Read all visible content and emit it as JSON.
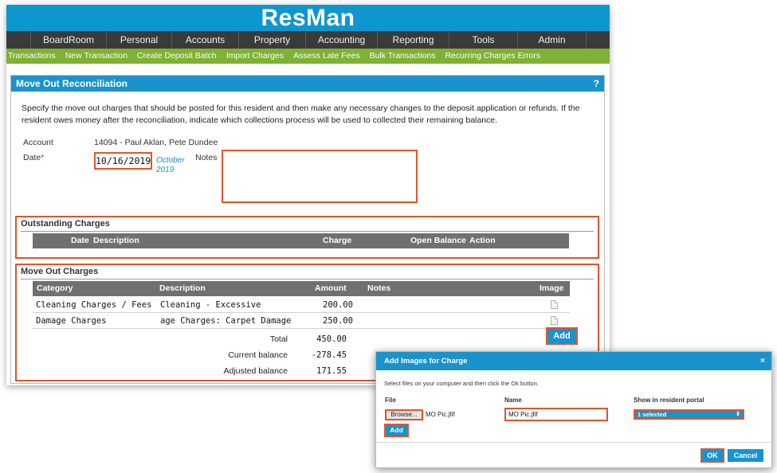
{
  "app": {
    "brand": "ResMan"
  },
  "top_nav": [
    "BoardRoom",
    "Personal",
    "Accounts",
    "Property",
    "Accounting",
    "Reporting",
    "Tools",
    "Admin"
  ],
  "sub_nav": [
    "Transactions",
    "New Transaction",
    "Create Deposit Batch",
    "Import Charges",
    "Assess Late Fees",
    "Bulk Transactions",
    "Recurring Charges Errors"
  ],
  "panel": {
    "title": "Move Out Reconciliation",
    "help": "?",
    "intro": "Specify the move out charges that should be posted for this resident and then make any necessary changes to the deposit application or refunds. If the resident owes money after the reconciliation, indicate which collections process will be used to collected their remaining balance."
  },
  "form": {
    "account_label": "Account",
    "account_value": "14094 - Paul Aklan, Pete Dundee",
    "date_label": "Date",
    "date_required": "*",
    "date_value": "10/16/2019",
    "calendar_link": "October 2019",
    "notes_label": "Notes",
    "notes_value": ""
  },
  "outstanding": {
    "title": "Outstanding Charges",
    "headers": {
      "date": "Date",
      "description": "Description",
      "charge": "Charge",
      "open_balance": "Open Balance",
      "action": "Action"
    }
  },
  "move_out": {
    "title": "Move Out Charges",
    "headers": {
      "category": "Category",
      "description": "Description",
      "amount": "Amount",
      "notes": "Notes",
      "image": "Image"
    },
    "rows": [
      {
        "category": "Cleaning Charges / Fees",
        "description": "Cleaning - Excessive",
        "amount": "200.00",
        "image_icon": "file-icon"
      },
      {
        "category": "Damage Charges",
        "description": "age Charges: Carpet Damage",
        "amount": "250.00",
        "image_icon": "file-icon"
      }
    ],
    "total_label": "Total",
    "total_value": "450.00",
    "current_balance_label": "Current balance",
    "current_balance_value": "-278.45",
    "adjusted_balance_label": "Adjusted balance",
    "adjusted_balance_value": "171.55",
    "add_label": "Add"
  },
  "dialog": {
    "title": "Add Images for Charge",
    "close": "×",
    "instructions": "Select files on your computer and then click the Ok button.",
    "file_label": "File",
    "browse_label": "Browse...",
    "file_name": "MO Pic.jfif",
    "name_label": "Name",
    "name_value": "MO Pic.jfif",
    "portal_label": "Show in resident portal",
    "portal_value": "1 selected",
    "add_label": "Add",
    "ok_label": "OK",
    "cancel_label": "Cancel"
  },
  "colors": {
    "brand_blue": "#1a93cc",
    "nav_dark": "#3a3a3a",
    "sub_nav_green": "#7eb134",
    "highlight_orange": "#e1542b",
    "table_header_gray": "#707070"
  }
}
